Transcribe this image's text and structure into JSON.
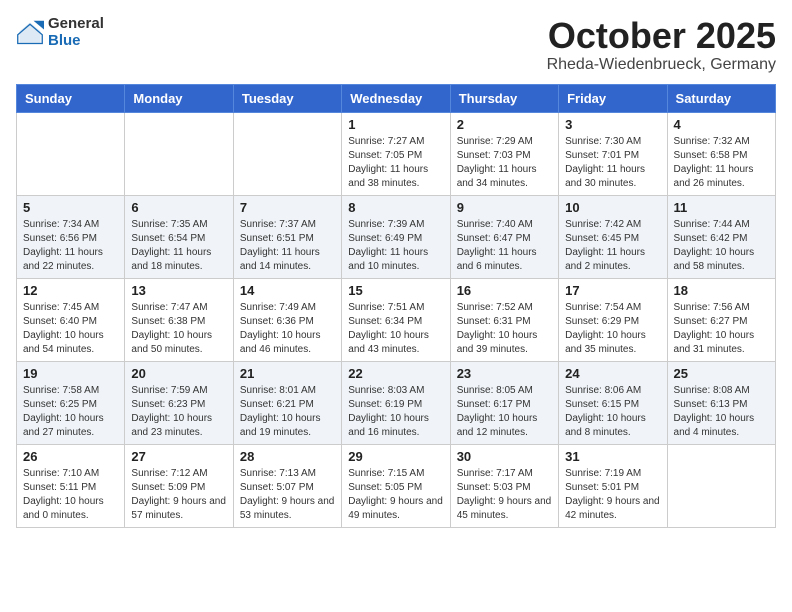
{
  "header": {
    "logo_general": "General",
    "logo_blue": "Blue",
    "month": "October 2025",
    "location": "Rheda-Wiedenbrueck, Germany"
  },
  "weekdays": [
    "Sunday",
    "Monday",
    "Tuesday",
    "Wednesday",
    "Thursday",
    "Friday",
    "Saturday"
  ],
  "weeks": [
    [
      {
        "day": "",
        "info": ""
      },
      {
        "day": "",
        "info": ""
      },
      {
        "day": "",
        "info": ""
      },
      {
        "day": "1",
        "info": "Sunrise: 7:27 AM\nSunset: 7:05 PM\nDaylight: 11 hours\nand 38 minutes."
      },
      {
        "day": "2",
        "info": "Sunrise: 7:29 AM\nSunset: 7:03 PM\nDaylight: 11 hours\nand 34 minutes."
      },
      {
        "day": "3",
        "info": "Sunrise: 7:30 AM\nSunset: 7:01 PM\nDaylight: 11 hours\nand 30 minutes."
      },
      {
        "day": "4",
        "info": "Sunrise: 7:32 AM\nSunset: 6:58 PM\nDaylight: 11 hours\nand 26 minutes."
      }
    ],
    [
      {
        "day": "5",
        "info": "Sunrise: 7:34 AM\nSunset: 6:56 PM\nDaylight: 11 hours\nand 22 minutes."
      },
      {
        "day": "6",
        "info": "Sunrise: 7:35 AM\nSunset: 6:54 PM\nDaylight: 11 hours\nand 18 minutes."
      },
      {
        "day": "7",
        "info": "Sunrise: 7:37 AM\nSunset: 6:51 PM\nDaylight: 11 hours\nand 14 minutes."
      },
      {
        "day": "8",
        "info": "Sunrise: 7:39 AM\nSunset: 6:49 PM\nDaylight: 11 hours\nand 10 minutes."
      },
      {
        "day": "9",
        "info": "Sunrise: 7:40 AM\nSunset: 6:47 PM\nDaylight: 11 hours\nand 6 minutes."
      },
      {
        "day": "10",
        "info": "Sunrise: 7:42 AM\nSunset: 6:45 PM\nDaylight: 11 hours\nand 2 minutes."
      },
      {
        "day": "11",
        "info": "Sunrise: 7:44 AM\nSunset: 6:42 PM\nDaylight: 10 hours\nand 58 minutes."
      }
    ],
    [
      {
        "day": "12",
        "info": "Sunrise: 7:45 AM\nSunset: 6:40 PM\nDaylight: 10 hours\nand 54 minutes."
      },
      {
        "day": "13",
        "info": "Sunrise: 7:47 AM\nSunset: 6:38 PM\nDaylight: 10 hours\nand 50 minutes."
      },
      {
        "day": "14",
        "info": "Sunrise: 7:49 AM\nSunset: 6:36 PM\nDaylight: 10 hours\nand 46 minutes."
      },
      {
        "day": "15",
        "info": "Sunrise: 7:51 AM\nSunset: 6:34 PM\nDaylight: 10 hours\nand 43 minutes."
      },
      {
        "day": "16",
        "info": "Sunrise: 7:52 AM\nSunset: 6:31 PM\nDaylight: 10 hours\nand 39 minutes."
      },
      {
        "day": "17",
        "info": "Sunrise: 7:54 AM\nSunset: 6:29 PM\nDaylight: 10 hours\nand 35 minutes."
      },
      {
        "day": "18",
        "info": "Sunrise: 7:56 AM\nSunset: 6:27 PM\nDaylight: 10 hours\nand 31 minutes."
      }
    ],
    [
      {
        "day": "19",
        "info": "Sunrise: 7:58 AM\nSunset: 6:25 PM\nDaylight: 10 hours\nand 27 minutes."
      },
      {
        "day": "20",
        "info": "Sunrise: 7:59 AM\nSunset: 6:23 PM\nDaylight: 10 hours\nand 23 minutes."
      },
      {
        "day": "21",
        "info": "Sunrise: 8:01 AM\nSunset: 6:21 PM\nDaylight: 10 hours\nand 19 minutes."
      },
      {
        "day": "22",
        "info": "Sunrise: 8:03 AM\nSunset: 6:19 PM\nDaylight: 10 hours\nand 16 minutes."
      },
      {
        "day": "23",
        "info": "Sunrise: 8:05 AM\nSunset: 6:17 PM\nDaylight: 10 hours\nand 12 minutes."
      },
      {
        "day": "24",
        "info": "Sunrise: 8:06 AM\nSunset: 6:15 PM\nDaylight: 10 hours\nand 8 minutes."
      },
      {
        "day": "25",
        "info": "Sunrise: 8:08 AM\nSunset: 6:13 PM\nDaylight: 10 hours\nand 4 minutes."
      }
    ],
    [
      {
        "day": "26",
        "info": "Sunrise: 7:10 AM\nSunset: 5:11 PM\nDaylight: 10 hours\nand 0 minutes."
      },
      {
        "day": "27",
        "info": "Sunrise: 7:12 AM\nSunset: 5:09 PM\nDaylight: 9 hours\nand 57 minutes."
      },
      {
        "day": "28",
        "info": "Sunrise: 7:13 AM\nSunset: 5:07 PM\nDaylight: 9 hours\nand 53 minutes."
      },
      {
        "day": "29",
        "info": "Sunrise: 7:15 AM\nSunset: 5:05 PM\nDaylight: 9 hours\nand 49 minutes."
      },
      {
        "day": "30",
        "info": "Sunrise: 7:17 AM\nSunset: 5:03 PM\nDaylight: 9 hours\nand 45 minutes."
      },
      {
        "day": "31",
        "info": "Sunrise: 7:19 AM\nSunset: 5:01 PM\nDaylight: 9 hours\nand 42 minutes."
      },
      {
        "day": "",
        "info": ""
      }
    ]
  ]
}
